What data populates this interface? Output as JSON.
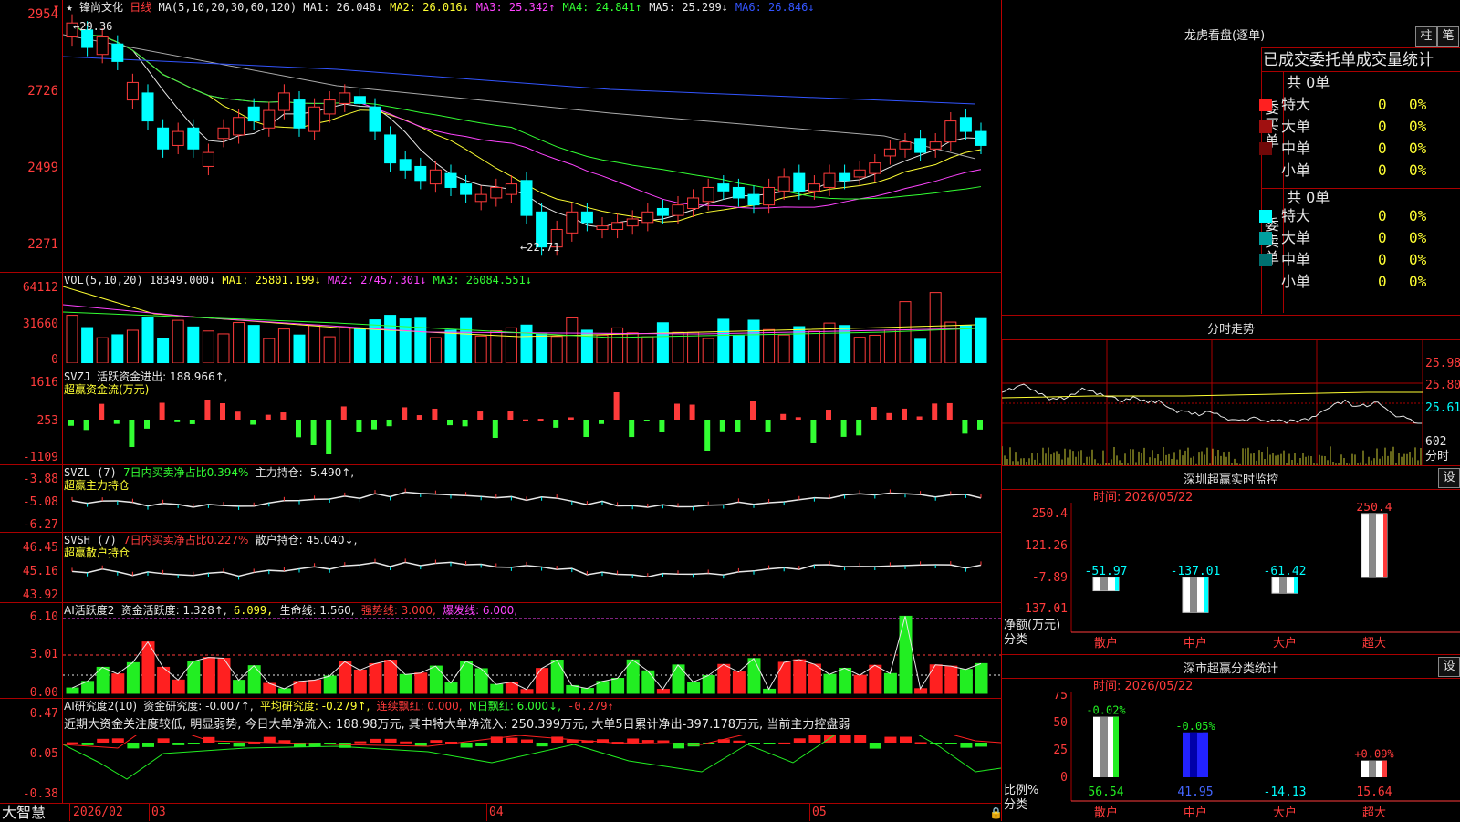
{
  "main": {
    "stock_name": "锋尚文化",
    "period": "日线",
    "ma_header": "MA(5,10,20,30,60,120)",
    "ma": [
      {
        "label": "MA1: 26.048↓",
        "color": "#e8e8e8"
      },
      {
        "label": "MA2: 26.016↓",
        "color": "#ffff33"
      },
      {
        "label": "MA3: 25.342↑",
        "color": "#ff44ff"
      },
      {
        "label": "MA4: 24.841↑",
        "color": "#33ff33"
      },
      {
        "label": "MA5: 25.299↓",
        "color": "#e8e8e8"
      },
      {
        "label": "MA6: 26.846↓",
        "color": "#3355ff"
      }
    ],
    "price_axis": [
      "2954",
      "2726",
      "2499",
      "2271"
    ],
    "high_mark": "29.36",
    "low_mark": "22.71"
  },
  "vol": {
    "header": "VOL(5,10,20)",
    "value": "18349.000↓",
    "ma1": "MA1: 25801.199↓",
    "ma2": "MA2: 27457.301↓",
    "ma3": "MA3: 26084.551↓",
    "axis": [
      "64112",
      "31660",
      "0"
    ]
  },
  "svzj": {
    "name": "SVZJ",
    "label": "活跃资金进出: 188.966↑,",
    "sub": "超赢资金流(万元)",
    "axis": [
      "1616",
      "253",
      "-1109"
    ]
  },
  "svzl": {
    "name": "SVZL (7)",
    "label1": "7日内买卖净占比0.394%",
    "label2": "主力持仓: -5.490↑,",
    "sub": "超赢主力持仓",
    "axis": [
      "-3.88",
      "-5.08",
      "-6.27"
    ]
  },
  "svsh": {
    "name": "SVSH (7)",
    "label1": "7日内买卖净占比0.227%",
    "label2": "散户持仓: 45.040↓,",
    "sub": "超赢散户持仓",
    "axis": [
      "46.45",
      "45.16",
      "43.92"
    ]
  },
  "ai_active": {
    "name": "AI活跃度2",
    "l1": "资金活跃度: 1.328↑,",
    "l2": "6.099,",
    "l3": "生命线: 1.560,",
    "l4": "强势线: 3.000,",
    "l5": "爆发线: 6.000,",
    "axis": [
      "6.10",
      "3.01",
      "0.00"
    ]
  },
  "ai_research": {
    "name": "AI研究度2(10)",
    "l1": "资金研究度: -0.007↑,",
    "l2": "平均研究度: -0.279↑,",
    "l3": "连续飘红: 0.000,",
    "l4": "N日飘红: 6.000↓,",
    "l5": "-0.279↑",
    "desc": "近期大资金关注度较低, 明显弱势, 今日大单净流入: 188.98万元, 其中特大单净流入: 250.399万元, 大单5日累计净出-397.178万元, 当前主力控盘弱",
    "axis": [
      "0.47",
      "0.05",
      "-0.38"
    ]
  },
  "x_axis": {
    "logo": "大智慧",
    "labels": [
      "2026/02",
      "03",
      "04",
      "05"
    ]
  },
  "dragon_tiger": {
    "title": "龙虎看盘(逐单)",
    "btn1": "柱",
    "btn2": "笔",
    "tabs": "已成交委托单成交量统计",
    "buy_side": "委买单",
    "sell_side": "委卖单",
    "buy_total": "共 0单",
    "sell_total": "共 0单",
    "buy_rows": [
      {
        "label": "特大",
        "count": "0",
        "pct": "0%",
        "color": "#ff2020"
      },
      {
        "label": "大单",
        "count": "0",
        "pct": "0%",
        "color": "#a01010"
      },
      {
        "label": "中单",
        "count": "0",
        "pct": "0%",
        "color": "#700808"
      },
      {
        "label": "小单",
        "count": "0",
        "pct": "0%",
        "color": ""
      }
    ],
    "sell_rows": [
      {
        "label": "特大",
        "count": "0",
        "pct": "0%",
        "color": "#00ffff"
      },
      {
        "label": "大单",
        "count": "0",
        "pct": "0%",
        "color": "#00a0a0"
      },
      {
        "label": "中单",
        "count": "0",
        "pct": "0%",
        "color": "#007070"
      },
      {
        "label": "小单",
        "count": "0",
        "pct": "0%",
        "color": ""
      }
    ]
  },
  "intraday": {
    "title": "分时走势",
    "axis": [
      "25.98",
      "25.80",
      "25.61"
    ],
    "vol_label": "602",
    "time_label": "分时"
  },
  "sz_monitor": {
    "title": "深圳超赢实时监控",
    "settings": "设",
    "time": "时间: 2026/05/22",
    "axis": [
      "250.4",
      "121.26",
      "-7.89",
      "-137.01"
    ],
    "ylabel": "净额(万元)",
    "xlabel": "分类",
    "categories": [
      "散户",
      "中户",
      "大户",
      "超大"
    ],
    "values": [
      "-51.97",
      "-137.01",
      "-61.42",
      "250.4"
    ]
  },
  "sz_class": {
    "title": "深市超赢分类统计",
    "settings": "设",
    "time": "时间: 2026/05/22",
    "axis": [
      "75",
      "50",
      "25",
      "0"
    ],
    "ylabel": "比例%",
    "xlabel": "分类",
    "categories": [
      "散户",
      "中户",
      "大户",
      "超大"
    ],
    "top_labels": [
      "-0.02%",
      "-0.05%",
      "",
      "+0.09%"
    ],
    "bottom_values": [
      "56.54",
      "41.95",
      "-14.13",
      "15.64"
    ]
  }
}
